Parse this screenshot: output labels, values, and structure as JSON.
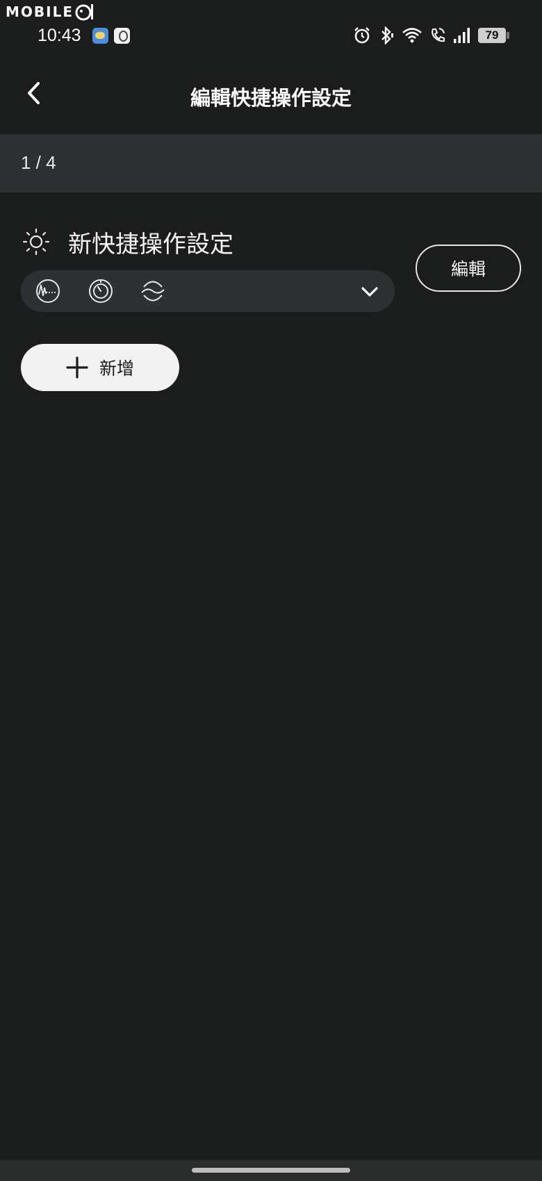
{
  "watermark": {
    "text": "MOBILE"
  },
  "status_bar": {
    "time": "10:43",
    "battery": "79",
    "icons": [
      "weather-app-icon",
      "accessory-app-icon",
      "alarm-icon",
      "bluetooth-icon",
      "wifi-icon",
      "wifi-call-icon",
      "signal-icon",
      "battery-icon"
    ]
  },
  "header": {
    "title": "編輯快捷操作設定",
    "back_icon": "chevron-left-icon"
  },
  "pager": {
    "text": "1 / 4"
  },
  "setting": {
    "title": "新快捷操作設定",
    "icon": "sun-icon",
    "modes": [
      "noise-cancel-icon",
      "timer-icon",
      "ambient-icon"
    ],
    "expand_icon": "chevron-down-icon",
    "edit_label": "編輯"
  },
  "add_button": {
    "label": "新增",
    "icon": "plus-icon"
  }
}
